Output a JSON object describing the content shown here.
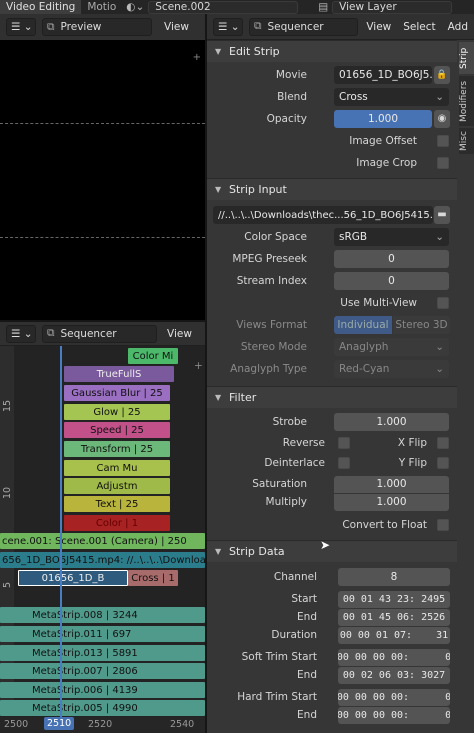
{
  "topbar": {
    "workspace_tab": "Video Editing",
    "motion_tab": "Motio",
    "scene_field": "Scene.002",
    "view_layer_field": "View Layer"
  },
  "preview": {
    "editor_menu": "☰ ⌄",
    "mode": "Preview",
    "view_menu": "View"
  },
  "props_header": {
    "editor_menu": "☰ ⌄",
    "mode": "Sequencer",
    "menus": [
      "View",
      "Select",
      "Add"
    ]
  },
  "side_tabs": [
    "Strip",
    "Modifiers",
    "Misc"
  ],
  "edit_strip": {
    "title": "Edit Strip",
    "movie_label": "Movie",
    "movie_value": "01656_1D_BO6J5...",
    "blend_label": "Blend",
    "blend_value": "Cross",
    "opacity_label": "Opacity",
    "opacity_value": "1.000",
    "image_offset_label": "Image Offset",
    "image_crop_label": "Image Crop"
  },
  "strip_input": {
    "title": "Strip Input",
    "path": "//..\\..\\..\\Downloads\\thec...56_1D_BO6J5415.mp4",
    "color_space_label": "Color Space",
    "color_space_value": "sRGB",
    "mpeg_preseek_label": "MPEG Preseek",
    "mpeg_preseek_value": "0",
    "stream_index_label": "Stream Index",
    "stream_index_value": "0",
    "multi_view_label": "Use Multi-View",
    "views_format_label": "Views Format",
    "views_format_individual": "Individual",
    "views_format_stereo": "Stereo 3D",
    "stereo_mode_label": "Stereo Mode",
    "stereo_mode_value": "Anaglyph",
    "anaglyph_type_label": "Anaglyph Type",
    "anaglyph_type_value": "Red-Cyan"
  },
  "filter": {
    "title": "Filter",
    "strobe_label": "Strobe",
    "strobe_value": "1.000",
    "reverse_label": "Reverse",
    "xflip_label": "X Flip",
    "deinterlace_label": "Deinterlace",
    "yflip_label": "Y Flip",
    "saturation_label": "Saturation",
    "saturation_value": "1.000",
    "multiply_label": "Multiply",
    "multiply_value": "1.000",
    "float_label": "Convert to Float"
  },
  "strip_data": {
    "title": "Strip Data",
    "channel_label": "Channel",
    "channel_value": "8",
    "start_label": "Start",
    "start_value": "00 01 43 23: 2495",
    "end_label": "End",
    "end_value": "00 01 45 06: 2526",
    "duration_label": "Duration",
    "duration_value": "00 00 01 07:    31",
    "soft_trim_start_label": "Soft Trim Start",
    "soft_trim_start_value": "00 00 00 00:      0",
    "soft_trim_end_label": "End",
    "soft_trim_end_value": "00 02 06 03: 3027",
    "hard_trim_start_label": "Hard Trim Start",
    "hard_trim_start_value": "00 00 00 00:      0",
    "hard_trim_end_label": "End",
    "hard_trim_end_value": "00 00 00 00:      0"
  },
  "sequencer": {
    "editor_menu": "☰ ⌄",
    "mode": "Sequencer",
    "view_menu": "View",
    "ruler_labels": [
      "15",
      "10",
      "5"
    ],
    "frame_labels": [
      "2500",
      "2510",
      "2520",
      "2540"
    ],
    "strips": {
      "color_mi": "Color Mi",
      "truefulls": "TrueFullS",
      "gaussian": "Gaussian Blur | 25",
      "glow": "Glow | 25",
      "speed": "Speed | 25",
      "transform": "Transform | 25",
      "cam_mu": "Cam Mu",
      "adjustm": "Adjustm",
      "text": "Text | 25",
      "color1": "Color | 1",
      "scene001": "cene.001: Scene.001 (Camera) | 250",
      "movie_long": "656_1D_BO6J5415.mp4: //..\\..\\..\\Downloads",
      "movie_sel": "01656_1D_B",
      "cross": "Cross | 1",
      "meta8": "MetaStrip.008 | 3244",
      "meta11": "MetaStrip.011 | 697",
      "meta13": "MetaStrip.013 | 5891",
      "meta7": "MetaStrip.007 | 2806",
      "meta6": "MetaStrip.006 | 4139",
      "meta5": "MetaStrip.005 | 4990"
    }
  }
}
